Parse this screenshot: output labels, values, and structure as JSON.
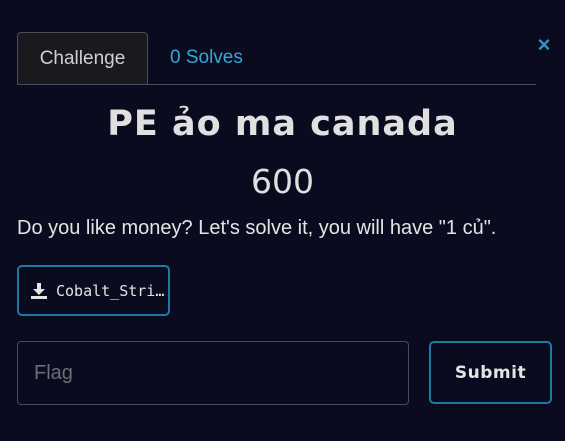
{
  "modal": {
    "close_icon": "close-icon",
    "close_glyph": "×"
  },
  "tabs": [
    {
      "label": "Challenge",
      "active": true
    },
    {
      "label": "0 Solves",
      "active": false
    }
  ],
  "challenge": {
    "name": "PE ảo ma canada",
    "points": "600",
    "description": "Do you like money? Let's solve it, you will have \"1 củ\".",
    "file": {
      "icon": "download-icon",
      "label": "Cobalt_Stri…"
    }
  },
  "flag_input": {
    "placeholder": "Flag",
    "value": ""
  },
  "submit_label": "Submit",
  "colors": {
    "background": "#0b0b1f",
    "accent": "#1e7aa4",
    "link": "#31a9d8"
  }
}
